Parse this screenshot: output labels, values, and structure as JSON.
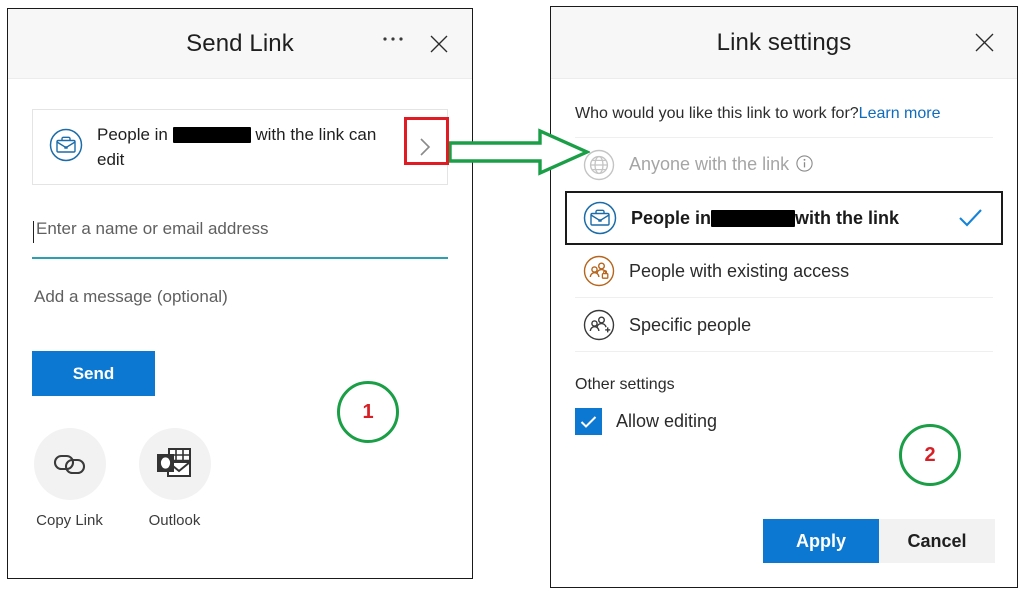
{
  "send_link": {
    "title": "Send Link",
    "ellipsis_label": "More options",
    "close_label": "Close",
    "permission": {
      "text_before": "People in",
      "text_after": "with the link can edit",
      "icon": "briefcase-circle-icon",
      "chevron": "chevron-right-icon",
      "redacted": true
    },
    "recipient_input": {
      "placeholder": "Enter a name or email address",
      "value": ""
    },
    "message_field": {
      "placeholder": "Add a message (optional)"
    },
    "send_button_label": "Send",
    "share_actions": [
      {
        "label": "Copy Link",
        "icon": "link-chain-icon"
      },
      {
        "label": "Outlook",
        "icon": "outlook-icon"
      }
    ]
  },
  "link_settings": {
    "title": "Link settings",
    "close_label": "Close",
    "question": "Who would you like this link to work for?",
    "learn_more_label": "Learn more",
    "options": [
      {
        "label": "Anyone with the link",
        "icon": "globe-icon",
        "disabled": true,
        "selected": false,
        "has_info_icon": true
      },
      {
        "label_before": "People in",
        "label_after": "with the link",
        "icon": "briefcase-circle-icon",
        "disabled": false,
        "selected": true,
        "redacted": true
      },
      {
        "label": "People with existing access",
        "icon": "people-lock-icon",
        "disabled": false,
        "selected": false
      },
      {
        "label": "Specific people",
        "icon": "people-add-icon",
        "disabled": false,
        "selected": false
      }
    ],
    "other_settings_label": "Other settings",
    "allow_editing": {
      "label": "Allow editing",
      "checked": true
    },
    "apply_label": "Apply",
    "cancel_label": "Cancel"
  },
  "annotations": {
    "step_one": "1",
    "step_two": "2",
    "highlight_color": "#e01b24",
    "circle_color": "#1a9e46",
    "number_color": "#d81f26",
    "arrow_color": "#1a9e46"
  },
  "colors": {
    "primary_blue": "#0d78d1",
    "link_blue": "#0f6cbd",
    "check_blue": "#1483d8",
    "input_underline": "#2d9fb0",
    "panel_border": "#1a1a1a",
    "header_bg": "#f7f7f7"
  }
}
